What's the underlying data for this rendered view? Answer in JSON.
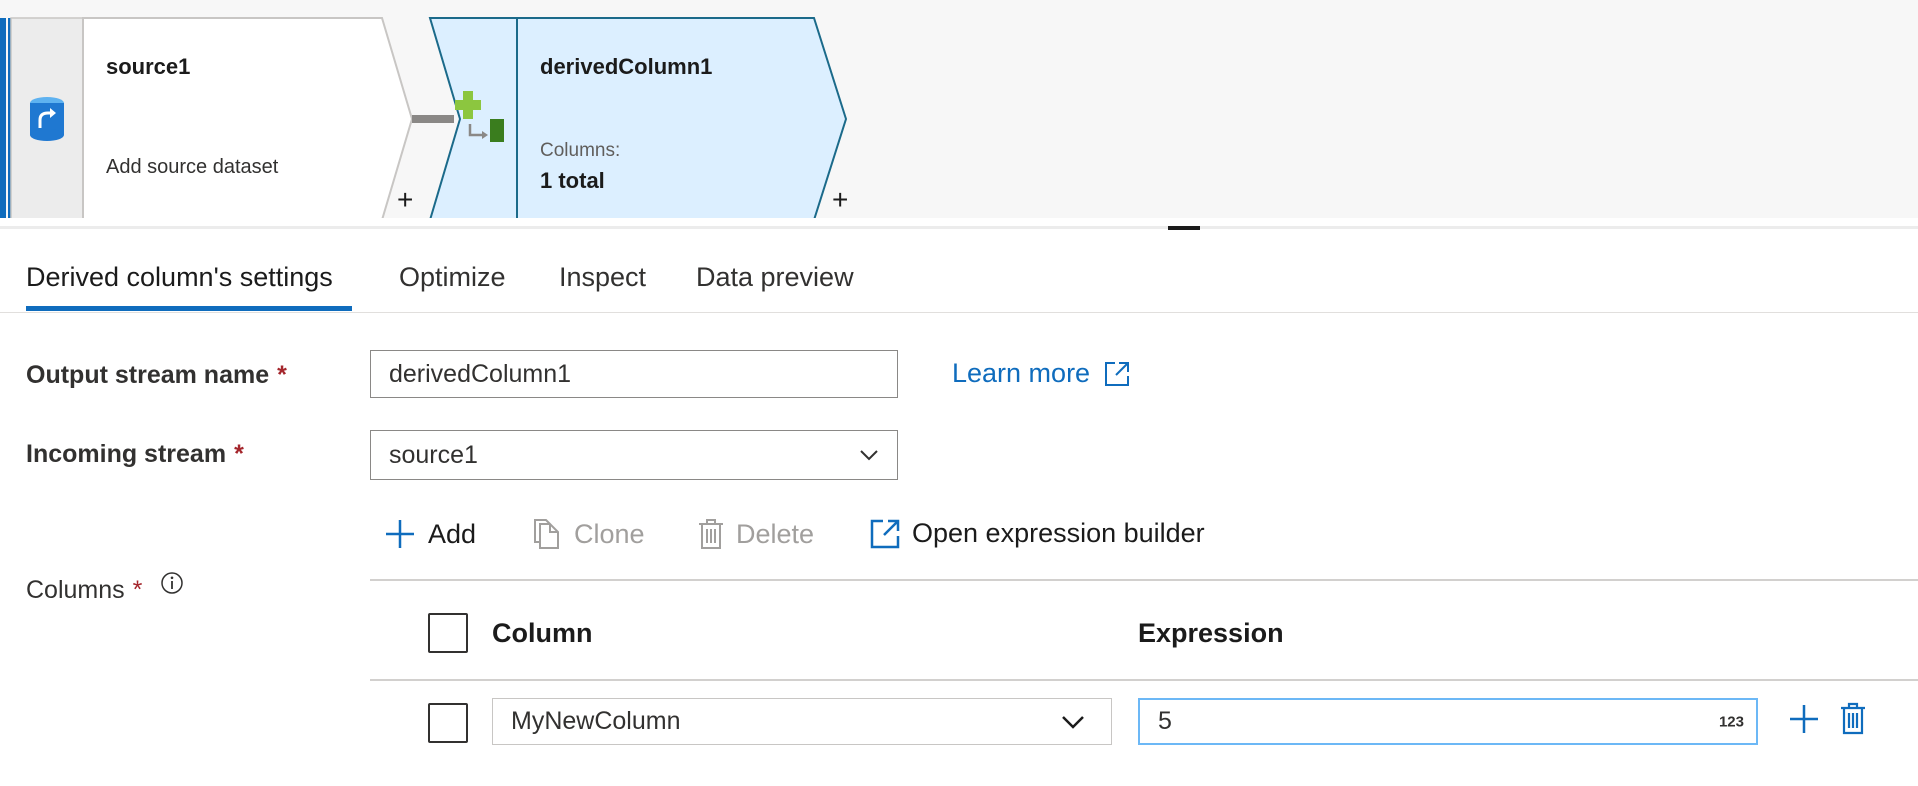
{
  "canvas": {
    "source_node": {
      "title": "source1",
      "subtitle": "Add source dataset",
      "icon": "database-source-icon"
    },
    "derived_node": {
      "title": "derivedColumn1",
      "columns_label": "Columns:",
      "columns_value": "1 total",
      "icon": "derived-column-icon"
    },
    "add_symbol": "+",
    "colors": {
      "selected_fill": "#dcefff",
      "selected_border": "#1b6a8a",
      "accent": "#0f6cbd"
    }
  },
  "tabs": [
    {
      "label": "Derived column's settings",
      "active": true
    },
    {
      "label": "Optimize",
      "active": false
    },
    {
      "label": "Inspect",
      "active": false
    },
    {
      "label": "Data preview",
      "active": false
    }
  ],
  "form": {
    "output_stream": {
      "label": "Output stream name",
      "required_mark": "*",
      "value": "derivedColumn1"
    },
    "learn_more": "Learn more",
    "incoming_stream": {
      "label": "Incoming stream",
      "required_mark": "*",
      "value": "source1"
    },
    "columns": {
      "label": "Columns",
      "required_mark": "*"
    }
  },
  "toolbar": {
    "add": "Add",
    "clone": "Clone",
    "delete": "Delete",
    "open_builder": "Open expression builder"
  },
  "grid": {
    "headers": {
      "column": "Column",
      "expression": "Expression"
    },
    "rows": [
      {
        "column": "MyNewColumn",
        "expression": "5",
        "type_badge": "123"
      }
    ]
  }
}
